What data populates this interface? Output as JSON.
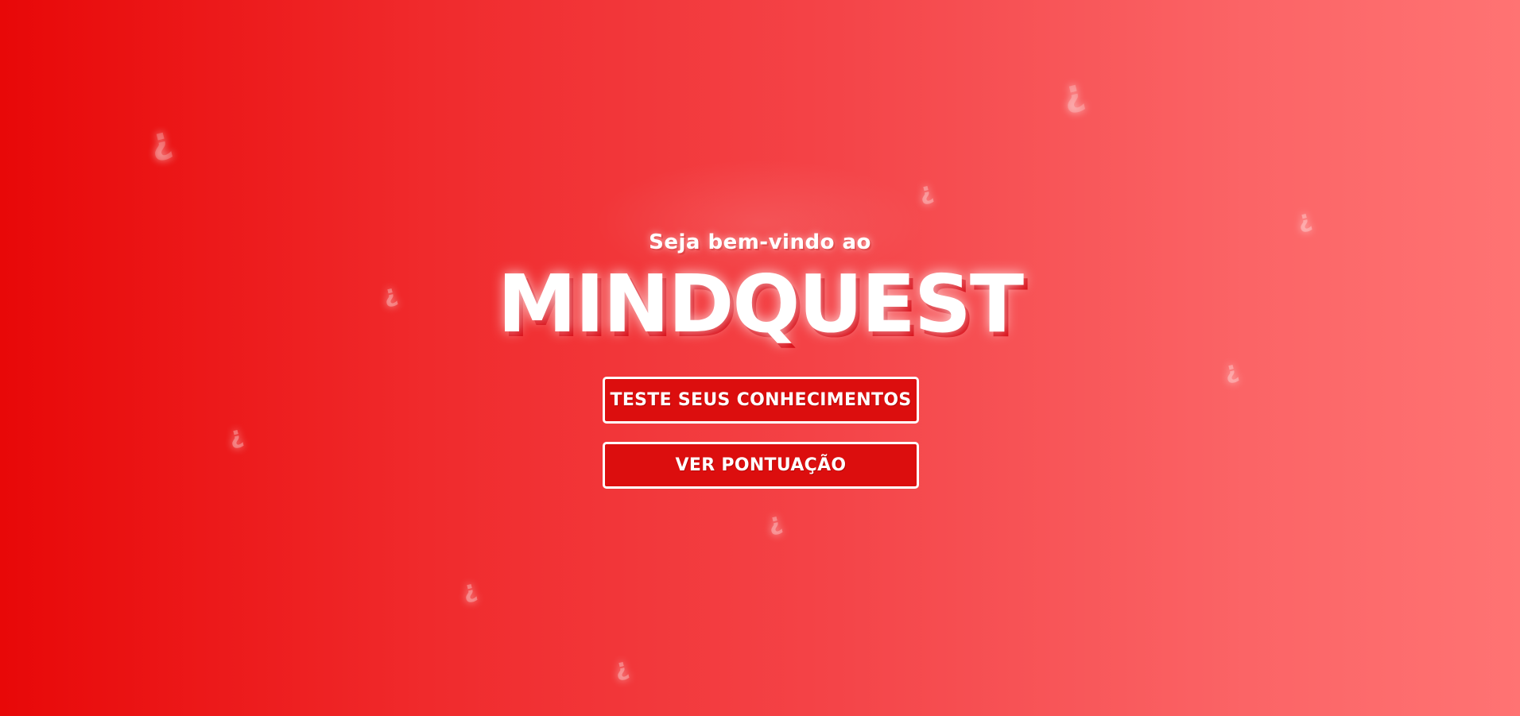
{
  "page": {
    "welcome_text": "Seja bem-vindo ao",
    "title": "MINDQUEST"
  },
  "buttons": {
    "test_knowledge_label": "TESTE SEUS CONHECIMENTOS",
    "view_score_label": "VER PONTUAÇÃO"
  },
  "decorations": {
    "question_mark_glyph": "¿"
  },
  "colors": {
    "background_start": "#e80808",
    "background_end": "#ff7373",
    "button_fill": "#dc0e0e",
    "button_border": "#ffffff",
    "title_shadow": "#d80610"
  }
}
